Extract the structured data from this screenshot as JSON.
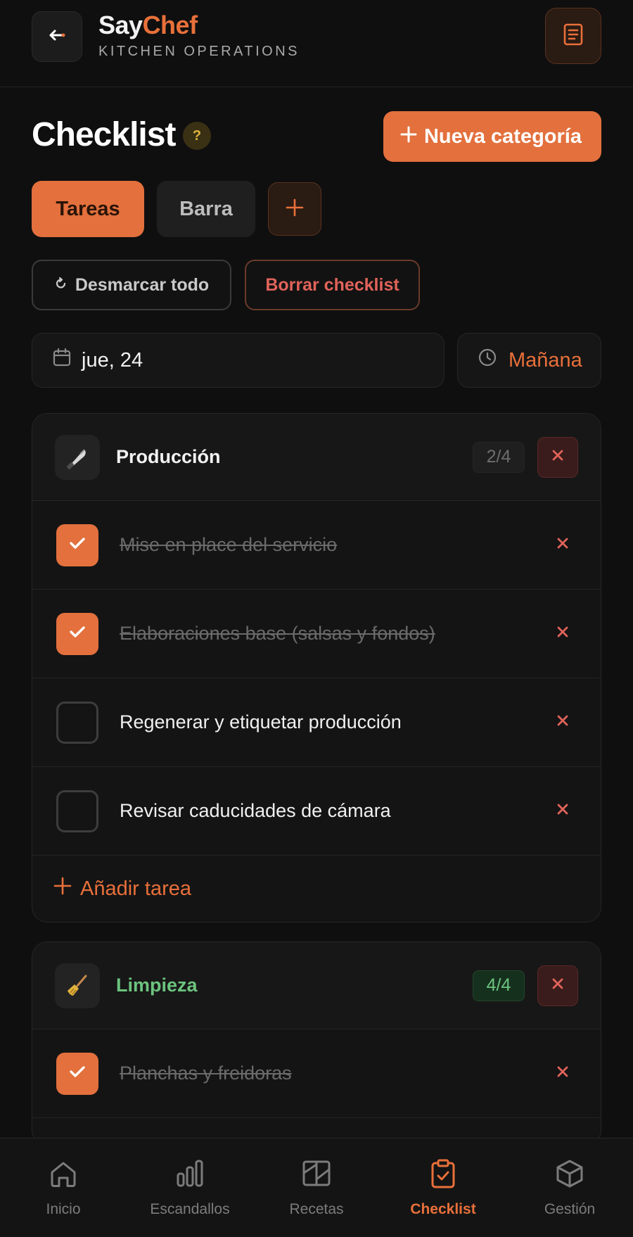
{
  "brand": {
    "name_say": "Say",
    "name_chef": "Chef",
    "subtitle": "KITCHEN OPERATIONS"
  },
  "page": {
    "title": "Checklist",
    "help_label": "?",
    "new_category_label": "Nueva categoría"
  },
  "tabs": [
    {
      "label": "Tareas",
      "active": true
    },
    {
      "label": "Barra",
      "active": false
    }
  ],
  "actions": {
    "uncheck_all": "Desmarcar todo",
    "clear_checklist": "Borrar checklist"
  },
  "date": {
    "value": "jue, 24"
  },
  "shift": {
    "value": "Mañana"
  },
  "categories": [
    {
      "name": "Producción",
      "icon": "knife-icon",
      "count": "2/4",
      "tasks": [
        {
          "label": "Mise en place del servicio",
          "done": true
        },
        {
          "label": "Elaboraciones base (salsas y fondos)",
          "done": true
        },
        {
          "label": "Regenerar y etiquetar producción",
          "done": false
        },
        {
          "label": "Revisar caducidades de cámara",
          "done": false
        }
      ],
      "add_task_label": "Añadir tarea"
    },
    {
      "name": "Limpieza",
      "icon": "broom-icon",
      "count": "4/4",
      "tasks": [
        {
          "label": "Planchas y freidoras",
          "done": true
        }
      ]
    }
  ],
  "nav": [
    {
      "label": "Inicio",
      "icon": "home-icon",
      "active": false
    },
    {
      "label": "Escandallos",
      "icon": "bar-chart-icon",
      "active": false
    },
    {
      "label": "Recetas",
      "icon": "book-icon",
      "active": false
    },
    {
      "label": "Checklist",
      "icon": "clipboard-check-icon",
      "active": true
    },
    {
      "label": "Gestión",
      "icon": "box-icon",
      "active": false
    }
  ],
  "colors": {
    "accent": "#e3703d",
    "danger": "#e0635a",
    "success": "#6cc47e",
    "background": "#0f0f0f"
  }
}
